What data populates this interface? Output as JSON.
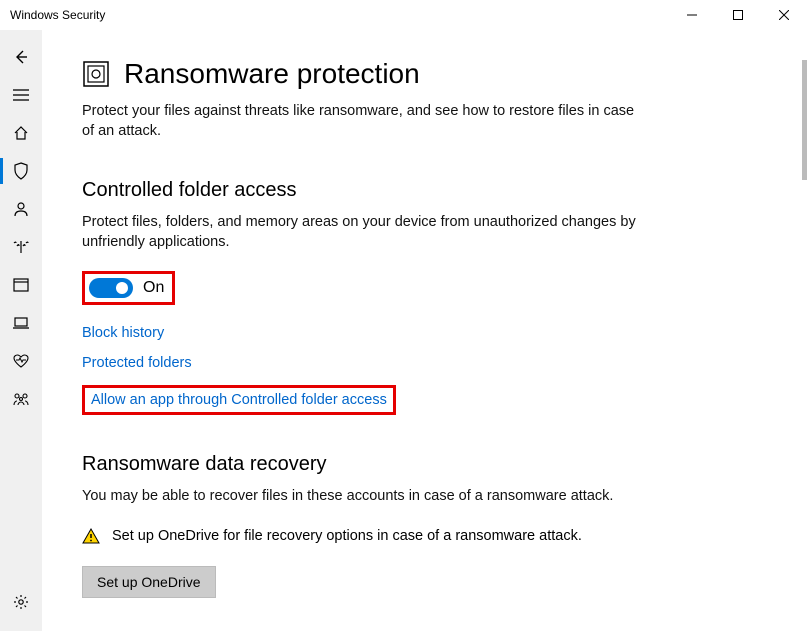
{
  "window": {
    "title": "Windows Security"
  },
  "page": {
    "title": "Ransomware protection",
    "description": "Protect your files against threats like ransomware, and see how to restore files in case of an attack."
  },
  "controlled_folder": {
    "heading": "Controlled folder access",
    "description": "Protect files, folders, and memory areas on your device from unauthorized changes by unfriendly applications.",
    "toggle_state": "On",
    "links": {
      "block_history": "Block history",
      "protected_folders": "Protected folders",
      "allow_app": "Allow an app through Controlled folder access"
    }
  },
  "recovery": {
    "heading": "Ransomware data recovery",
    "description": "You may be able to recover files in these accounts in case of a ransomware attack.",
    "warning": "Set up OneDrive for file recovery options in case of a ransomware attack.",
    "button": "Set up OneDrive"
  },
  "colors": {
    "accent": "#0078d7",
    "link": "#0066cc",
    "highlight": "#e50000"
  }
}
